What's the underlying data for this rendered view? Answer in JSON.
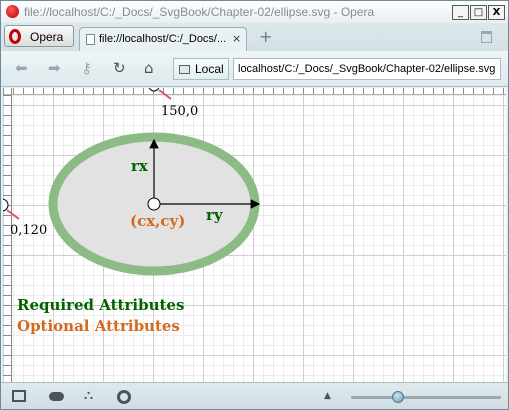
{
  "window": {
    "title": "file://localhost/C:/_Docs/_SvgBook/Chapter-02/ellipse.svg - Opera",
    "minimize": "_",
    "maximize": "□",
    "close": "X"
  },
  "tabs": {
    "menu_label": "Opera",
    "items": [
      {
        "label": "file://localhost/C:/_Docs/...",
        "close": "×"
      }
    ],
    "new_tab": "+"
  },
  "toolbar": {
    "security_label": "Local",
    "address": "localhost/C:/_Docs/_SvgBook/Chapter-02/ellipse.svg",
    "icons": [
      "back-icon",
      "forward-icon",
      "key-icon",
      "reload-icon",
      "home-icon"
    ]
  },
  "content": {
    "point_top_label": "150,0",
    "point_left_label": "0,120",
    "rx_label": "rx",
    "ry_label": "ry",
    "center_label": "(cx,cy)",
    "legend_required": "Required Attributes",
    "legend_optional": "Optional Attributes",
    "colors": {
      "ellipse_fill": "#e2e2e2",
      "ellipse_stroke": "#8dbb86",
      "required": "#006400",
      "optional": "#d2691e",
      "marker": "#d9536b"
    }
  },
  "statusbar": {
    "icons": [
      "panel-icon",
      "cloud-icon",
      "share-icon",
      "speed-dial-icon"
    ],
    "zoom_level": 0.3
  }
}
